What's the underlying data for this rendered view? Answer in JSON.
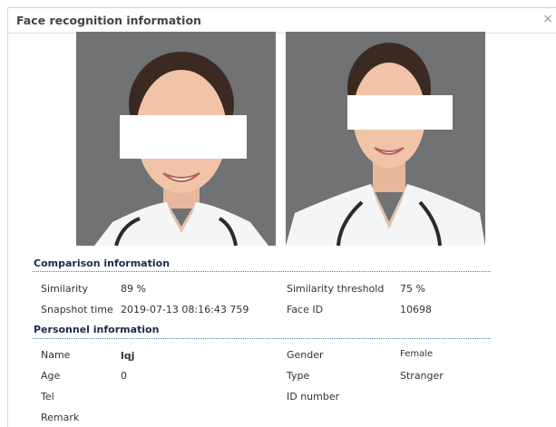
{
  "dialog": {
    "title": "Face recognition information",
    "close_glyph": "×"
  },
  "photos": {
    "snapshot_icon": "person-photo",
    "reference_icon": "person-photo",
    "background_color": "#707274"
  },
  "comparison": {
    "heading": "Comparison information",
    "similarity_label": "Similarity",
    "similarity_value": "89 %",
    "threshold_label": "Similarity threshold",
    "threshold_value": "75 %",
    "snapshot_time_label": "Snapshot time",
    "snapshot_time_value": "2019-07-13 08:16:43 759",
    "face_id_label": "Face ID",
    "face_id_value": "10698"
  },
  "personnel": {
    "heading": "Personnel information",
    "name_label": "Name",
    "name_value": "lqj",
    "gender_label": "Gender",
    "gender_value": "Female",
    "age_label": "Age",
    "age_value": "0",
    "type_label": "Type",
    "type_value": "Stranger",
    "tel_label": "Tel",
    "id_number_label": "ID number",
    "remark_label": "Remark"
  },
  "colors": {
    "section_rule": "#4a7ac0",
    "heading_text": "#1a2a4a"
  }
}
